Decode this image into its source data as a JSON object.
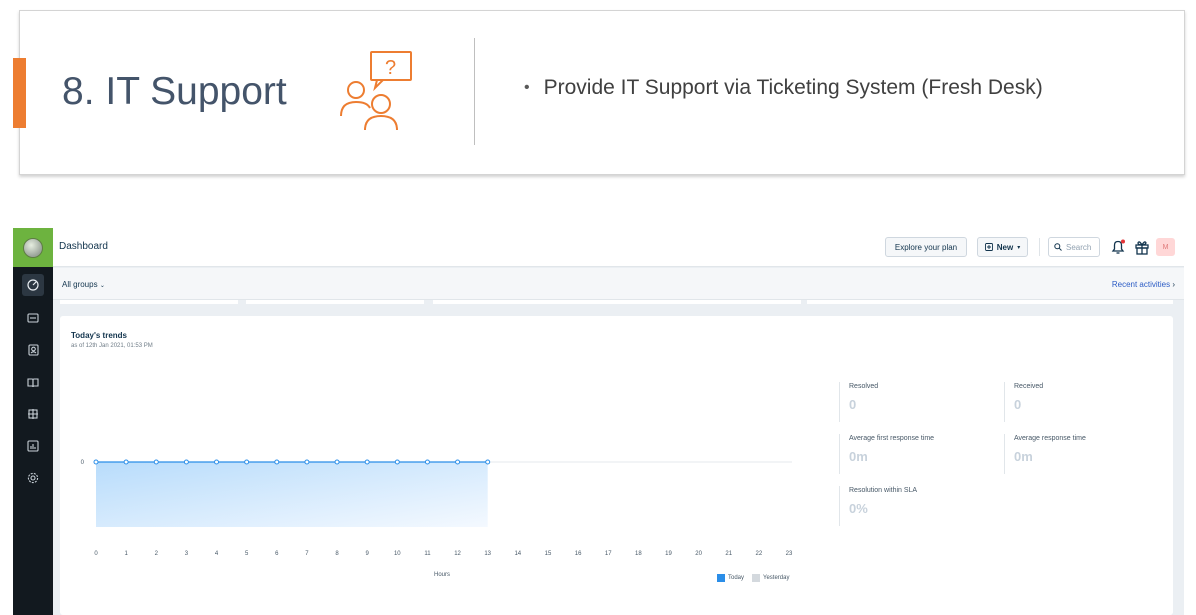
{
  "slide": {
    "title": "8. IT Support",
    "bullet": "Provide IT Support via Ticketing System (Fresh Desk)",
    "accent_color": "#ed7d31",
    "icon": "people-question-icon"
  },
  "app": {
    "page_title": "Dashboard",
    "explore_label": "Explore your plan",
    "new_label": "New",
    "search_placeholder": "Search",
    "avatar_initial": "M",
    "groups_filter": "All groups",
    "recent_activities": "Recent activities",
    "sidebar_icons": [
      "dashboard-icon",
      "tickets-icon",
      "contacts-icon",
      "solutions-icon",
      "forums-icon",
      "reports-icon",
      "admin-icon"
    ]
  },
  "trends": {
    "title": "Today's trends",
    "subtitle": "as of 12th Jan 2021, 01:53 PM",
    "x_axis_title": "Hours",
    "legend": {
      "today": "Today",
      "yesterday": "Yesterday"
    }
  },
  "metrics": [
    {
      "label": "Resolved",
      "value": "0"
    },
    {
      "label": "Received",
      "value": "0"
    },
    {
      "label": "Average first response time",
      "value": "0m"
    },
    {
      "label": "Average response time",
      "value": "0m"
    },
    {
      "label": "Resolution within SLA",
      "value": "0%"
    }
  ],
  "chart_data": {
    "type": "area",
    "title": "Today's trends",
    "xlabel": "Hours",
    "ylabel": "",
    "x": [
      0,
      1,
      2,
      3,
      4,
      5,
      6,
      7,
      8,
      9,
      10,
      11,
      12,
      13,
      14,
      15,
      16,
      17,
      18,
      19,
      20,
      21,
      22,
      23
    ],
    "y_ticks": [
      "0"
    ],
    "series": [
      {
        "name": "Today",
        "x": [
          0,
          1,
          2,
          3,
          4,
          5,
          6,
          7,
          8,
          9,
          10,
          11,
          12,
          13
        ],
        "values": [
          0,
          0,
          0,
          0,
          0,
          0,
          0,
          0,
          0,
          0,
          0,
          0,
          0,
          0
        ],
        "color": "#2b8ee8"
      },
      {
        "name": "Yesterday",
        "x": [],
        "values": [],
        "color": "#d4d9de"
      }
    ],
    "legend_position": "bottom-right",
    "grid": true
  }
}
